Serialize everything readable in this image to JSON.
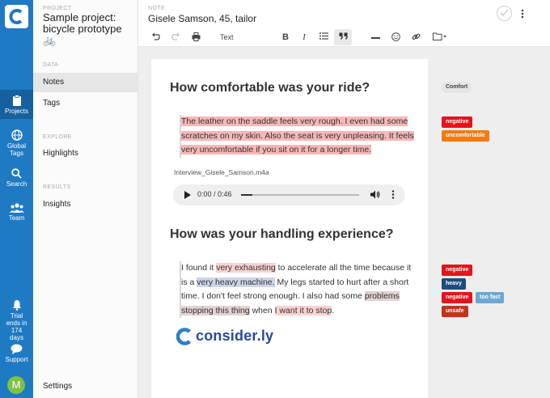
{
  "rail": {
    "projects_label": "Projects",
    "global_tags_label": "Global Tags",
    "search_label": "Search",
    "team_label": "Team",
    "trial_label": "Trial ends in 174 days",
    "support_label": "Support",
    "avatar_initial": "M",
    "accent_color": "#1f7ac4"
  },
  "panel": {
    "project_section_label": "PROJECT",
    "project_name": "Sample project: bicycle prototype 🚲",
    "data_section_label": "DATA",
    "notes_label": "Notes",
    "tags_label": "Tags",
    "explore_section_label": "EXPLORE",
    "highlights_label": "Highlights",
    "results_section_label": "RESULTS",
    "insights_label": "Insights",
    "settings_label": "Settings"
  },
  "header": {
    "note_section_label": "NOTE",
    "note_title": "Gisele Samson, 45, tailor",
    "toolbar": {
      "text_style_label": "Text",
      "bold_label": "B",
      "italic_label": "I"
    }
  },
  "note": {
    "heading_1": "How comfortable was your ride?",
    "quote_1": {
      "seg1": "The leather on the saddle feels very rough.  I even had some scratches on my skin. Also the seat is very unpleasing. It feels very uncomfortable if you sit on it for a longer time."
    },
    "audio_file_name": "Interview_Gisele_Samson.m4a",
    "audio_time": "0:00 / 0:46",
    "heading_2": "How was your handling experience?",
    "quote_2": {
      "p1": "I found it ",
      "h1": "very exhausting",
      "p2": " to accelerate all the time because it is a ",
      "h2": "very heavy machine.",
      "p3": " My legs started to hurt after a short time. I don't feel strong enough. I also had some ",
      "h3": "problems stopping this thing",
      "p4": " when ",
      "h4": "I want it to stop",
      "p5": "."
    },
    "brand_name": "consider.ly"
  },
  "tags": {
    "comfort": "Comfort",
    "negative": "negative",
    "uncomfortable": "uncomfortable",
    "heavy": "heavy",
    "too_fast": "too fast",
    "unsafe": "unsafe"
  }
}
